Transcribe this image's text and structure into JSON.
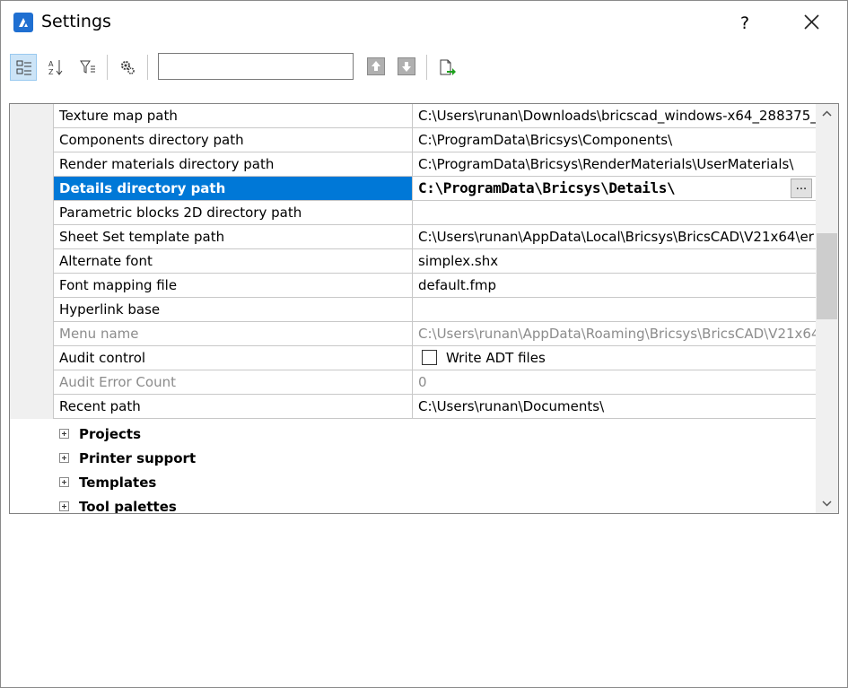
{
  "window": {
    "title": "Settings",
    "help_label": "?"
  },
  "toolbar": {
    "search_value": "",
    "buttons": [
      "categorized-view-icon",
      "sort-alphabetical-icon",
      "filter-icon",
      "settings-gear-icon",
      "arrow-up-icon",
      "arrow-down-icon",
      "export-icon"
    ]
  },
  "rows": [
    {
      "name": "Texture map path",
      "value": "C:\\Users\\runan\\Downloads\\bricscad_windows-x64_288375_"
    },
    {
      "name": "Components directory path",
      "value": "C:\\ProgramData\\Bricsys\\Components\\"
    },
    {
      "name": "Render materials directory path",
      "value": "C:\\ProgramData\\Bricsys\\RenderMaterials\\UserMaterials\\"
    },
    {
      "name": "Details directory path",
      "value": "C:\\ProgramData\\Bricsys\\Details\\",
      "ellipsis": "..."
    },
    {
      "name": "Parametric blocks 2D directory path",
      "value": ""
    },
    {
      "name": "Sheet Set template path",
      "value": "C:\\Users\\runan\\AppData\\Local\\Bricsys\\BricsCAD\\V21x64\\er"
    },
    {
      "name": "Alternate font",
      "value": "simplex.shx"
    },
    {
      "name": "Font mapping file",
      "value": "default.fmp"
    },
    {
      "name": "Hyperlink base",
      "value": ""
    },
    {
      "name": "Menu name",
      "value": "C:\\Users\\runan\\AppData\\Roaming\\Bricsys\\BricsCAD\\V21x64"
    },
    {
      "name": "Audit control",
      "value": "Write ADT files"
    },
    {
      "name": "Audit Error Count",
      "value": "0"
    },
    {
      "name": "Recent path",
      "value": "C:\\Users\\runan\\Documents\\"
    }
  ],
  "categories": [
    "Projects",
    "Printer support",
    "Templates",
    "Tool palettes"
  ]
}
